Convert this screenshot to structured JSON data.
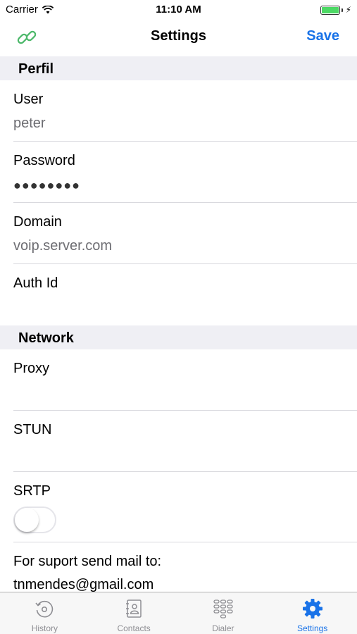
{
  "status_bar": {
    "carrier": "Carrier",
    "time": "11:10 AM"
  },
  "nav": {
    "title": "Settings",
    "save_label": "Save",
    "left_icon": "link-icon"
  },
  "sections": {
    "profile": {
      "header": "Perfil",
      "user": {
        "label": "User",
        "value": "peter"
      },
      "password": {
        "label": "Password",
        "value": "●●●●●●●●"
      },
      "domain": {
        "label": "Domain",
        "value": "voip.server.com"
      },
      "auth_id": {
        "label": "Auth Id",
        "value": ""
      }
    },
    "network": {
      "header": "Network",
      "proxy": {
        "label": "Proxy",
        "value": ""
      },
      "stun": {
        "label": "STUN",
        "value": ""
      },
      "srtp": {
        "label": "SRTP",
        "enabled": false
      }
    }
  },
  "support": {
    "label": "For suport send mail to:",
    "email": "tnmendes@gmail.com"
  },
  "tabs": [
    {
      "label": "History",
      "icon": "history-icon",
      "active": false
    },
    {
      "label": "Contacts",
      "icon": "contacts-icon",
      "active": false
    },
    {
      "label": "Dialer",
      "icon": "dialpad-icon",
      "active": false
    },
    {
      "label": "Settings",
      "icon": "gear-icon",
      "active": true
    }
  ],
  "colors": {
    "accent": "#1a73e8",
    "link_icon": "#4cb86a",
    "section_bg": "#efeff4",
    "inactive_tab": "#8e8e93",
    "battery": "#4cd964"
  }
}
